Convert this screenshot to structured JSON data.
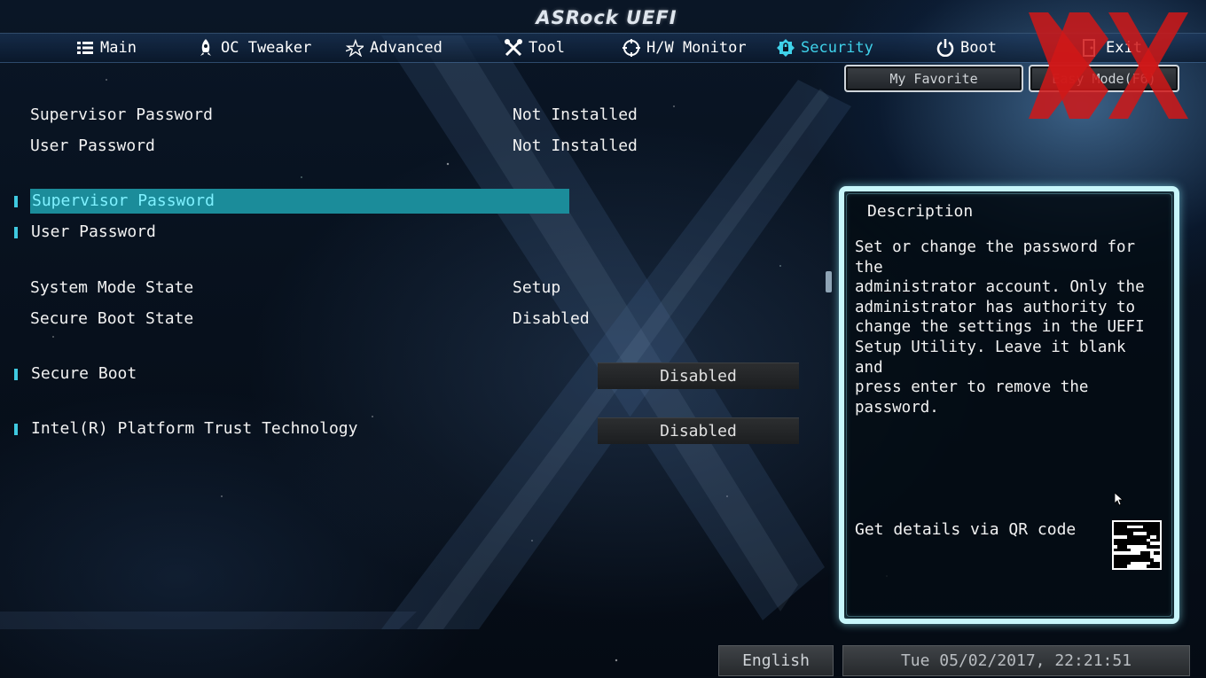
{
  "header": {
    "logo": "ASRock UEFI"
  },
  "tabs": [
    {
      "label": "Main",
      "icon": "list-icon"
    },
    {
      "label": "OC Tweaker",
      "icon": "rocket-icon"
    },
    {
      "label": "Advanced",
      "icon": "star-icon"
    },
    {
      "label": "Tool",
      "icon": "tools-icon"
    },
    {
      "label": "H/W Monitor",
      "icon": "monitor-icon"
    },
    {
      "label": "Security",
      "icon": "shield-icon",
      "active": true
    },
    {
      "label": "Boot",
      "icon": "power-icon"
    },
    {
      "label": "Exit",
      "icon": "exit-icon"
    }
  ],
  "top_buttons": {
    "favorite": "My Favorite",
    "easy_mode": "Easy Mode(F6)"
  },
  "status_rows": [
    {
      "label": "Supervisor Password",
      "value": "Not Installed"
    },
    {
      "label": "User Password",
      "value": "Not Installed"
    }
  ],
  "password_items": [
    {
      "label": "Supervisor Password",
      "selected": true
    },
    {
      "label": "User Password"
    }
  ],
  "state_rows": [
    {
      "label": "System Mode State",
      "value": "Setup"
    },
    {
      "label": "Secure Boot State",
      "value": "Disabled"
    }
  ],
  "options": [
    {
      "label": "Secure Boot",
      "value": "Disabled"
    },
    {
      "label": "Intel(R) Platform Trust Technology",
      "value": "Disabled"
    }
  ],
  "description": {
    "title": "Description",
    "text": "Set or change the password for the\nadministrator account. Only the\nadministrator has authority to\nchange the settings in the UEFI\nSetup Utility. Leave it blank and\npress enter to remove the password.",
    "qr_label": "Get details via QR code"
  },
  "footer": {
    "language": "English",
    "datetime": "Tue 05/02/2017, 22:21:51"
  },
  "colors": {
    "accent": "#3fd2ea",
    "highlight": "#1b8c9a",
    "panel_border": "#c7f6fb",
    "watermark": "#d01818"
  }
}
